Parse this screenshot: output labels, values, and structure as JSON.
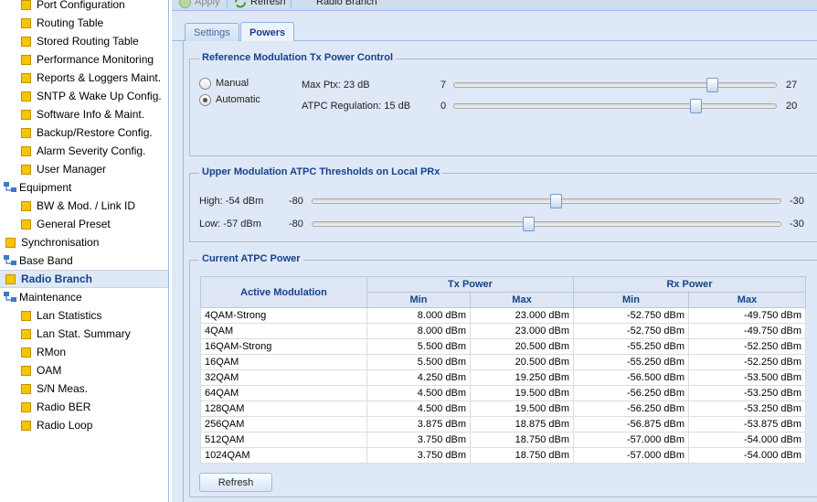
{
  "tree": {
    "items": [
      {
        "label": "Port Configuration",
        "kind": "leaf",
        "indent": 1
      },
      {
        "label": "Routing Table",
        "kind": "leaf",
        "indent": 1
      },
      {
        "label": "Stored Routing Table",
        "kind": "leaf",
        "indent": 1
      },
      {
        "label": "Performance Monitoring",
        "kind": "leaf",
        "indent": 1
      },
      {
        "label": "Reports & Loggers Maint.",
        "kind": "leaf",
        "indent": 1
      },
      {
        "label": "SNTP & Wake Up Config.",
        "kind": "leaf",
        "indent": 1
      },
      {
        "label": "Software Info & Maint.",
        "kind": "leaf",
        "indent": 1
      },
      {
        "label": "Backup/Restore Config.",
        "kind": "leaf",
        "indent": 1
      },
      {
        "label": "Alarm Severity Config.",
        "kind": "leaf",
        "indent": 1
      },
      {
        "label": "User Manager",
        "kind": "leaf",
        "indent": 1
      },
      {
        "label": "Equipment",
        "kind": "group",
        "indent": 0
      },
      {
        "label": "BW & Mod. / Link ID",
        "kind": "leaf",
        "indent": 1
      },
      {
        "label": "General Preset",
        "kind": "leaf",
        "indent": 1
      },
      {
        "label": "Synchronisation",
        "kind": "leaf",
        "indent": 0
      },
      {
        "label": "Base Band",
        "kind": "group",
        "indent": 0
      },
      {
        "label": "Radio Branch",
        "kind": "leaf",
        "indent": 0,
        "selected": true
      },
      {
        "label": "Maintenance",
        "kind": "group",
        "indent": 0
      },
      {
        "label": "Lan Statistics",
        "kind": "leaf",
        "indent": 1
      },
      {
        "label": "Lan Stat. Summary",
        "kind": "leaf",
        "indent": 1
      },
      {
        "label": "RMon",
        "kind": "leaf",
        "indent": 1
      },
      {
        "label": "OAM",
        "kind": "leaf",
        "indent": 1
      },
      {
        "label": "S/N Meas.",
        "kind": "leaf",
        "indent": 1
      },
      {
        "label": "Radio BER",
        "kind": "leaf",
        "indent": 1
      },
      {
        "label": "Radio Loop",
        "kind": "leaf",
        "indent": 1
      }
    ]
  },
  "toolbar": {
    "apply_label": "Apply",
    "refresh_label": "Refresh",
    "title": "Radio Branch"
  },
  "tabs": [
    {
      "label": "Settings",
      "active": false
    },
    {
      "label": "Powers",
      "active": true
    }
  ],
  "ref_mod": {
    "legend": "Reference Modulation Tx Power Control",
    "manual_label": "Manual",
    "automatic_label": "Automatic",
    "selected_mode": "Automatic",
    "max_ptx": {
      "label": "Max Ptx: 23 dB",
      "min": "7",
      "max": "27",
      "value": 23
    },
    "atpc_reg": {
      "label": "ATPC Regulation: 15 dB",
      "min": "0",
      "max": "20",
      "value": 15
    }
  },
  "upper_mod": {
    "legend": "Upper Modulation ATPC Thresholds on Local PRx",
    "high": {
      "label": "High: -54 dBm",
      "min": "-80",
      "max": "-30",
      "value": -54
    },
    "low": {
      "label": "Low: -57 dBm",
      "min": "-80",
      "max": "-30",
      "value": -57
    }
  },
  "current_atpc": {
    "legend": "Current ATPC Power",
    "headers": {
      "active_modulation": "Active Modulation",
      "tx_power": "Tx Power",
      "rx_power": "Rx Power",
      "min": "Min",
      "max": "Max"
    },
    "rows": [
      [
        "4QAM-Strong",
        "8.000 dBm",
        "23.000 dBm",
        "-52.750 dBm",
        "-49.750 dBm"
      ],
      [
        "4QAM",
        "8.000 dBm",
        "23.000 dBm",
        "-52.750 dBm",
        "-49.750 dBm"
      ],
      [
        "16QAM-Strong",
        "5.500 dBm",
        "20.500 dBm",
        "-55.250 dBm",
        "-52.250 dBm"
      ],
      [
        "16QAM",
        "5.500 dBm",
        "20.500 dBm",
        "-55.250 dBm",
        "-52.250 dBm"
      ],
      [
        "32QAM",
        "4.250 dBm",
        "19.250 dBm",
        "-56.500 dBm",
        "-53.500 dBm"
      ],
      [
        "64QAM",
        "4.500 dBm",
        "19.500 dBm",
        "-56.250 dBm",
        "-53.250 dBm"
      ],
      [
        "128QAM",
        "4.500 dBm",
        "19.500 dBm",
        "-56.250 dBm",
        "-53.250 dBm"
      ],
      [
        "256QAM",
        "3.875 dBm",
        "18.875 dBm",
        "-56.875 dBm",
        "-53.875 dBm"
      ],
      [
        "512QAM",
        "3.750 dBm",
        "18.750 dBm",
        "-57.000 dBm",
        "-54.000 dBm"
      ],
      [
        "1024QAM",
        "3.750 dBm",
        "18.750 dBm",
        "-57.000 dBm",
        "-54.000 dBm"
      ]
    ],
    "refresh_label": "Refresh"
  }
}
